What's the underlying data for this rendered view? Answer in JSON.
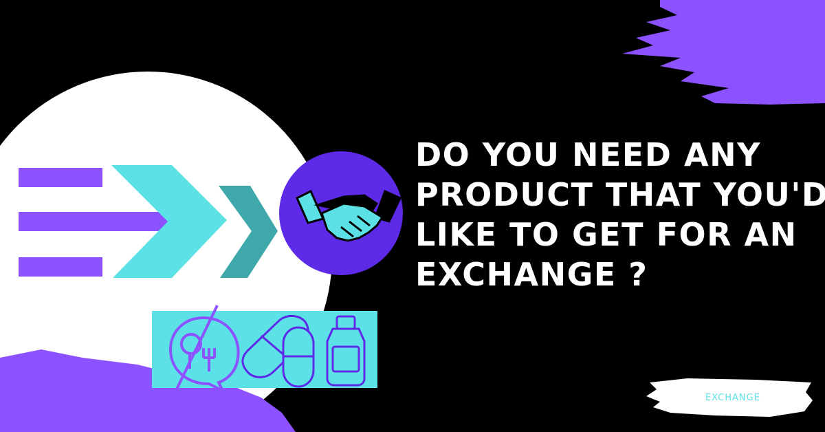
{
  "headline": {
    "lines": [
      "DO YOU NEED ANY",
      "PRODUCT THAT YOU'D",
      "LIKE TO GET FOR AN",
      "EXCHANGE ?"
    ]
  },
  "tag": {
    "label": "EXCHANGE"
  },
  "icons": {
    "logo": "ex-logo-icon",
    "handshake": "handshake-icon",
    "food": "no-food-icon",
    "pills": "pills-icon",
    "bottle": "medicine-bottle-icon"
  },
  "colors": {
    "background": "#000000",
    "purple": "#8c52ff",
    "violet": "#5d2ae8",
    "cyan": "#5ce1e6",
    "teal": "#3fa8aa",
    "white": "#ffffff"
  }
}
